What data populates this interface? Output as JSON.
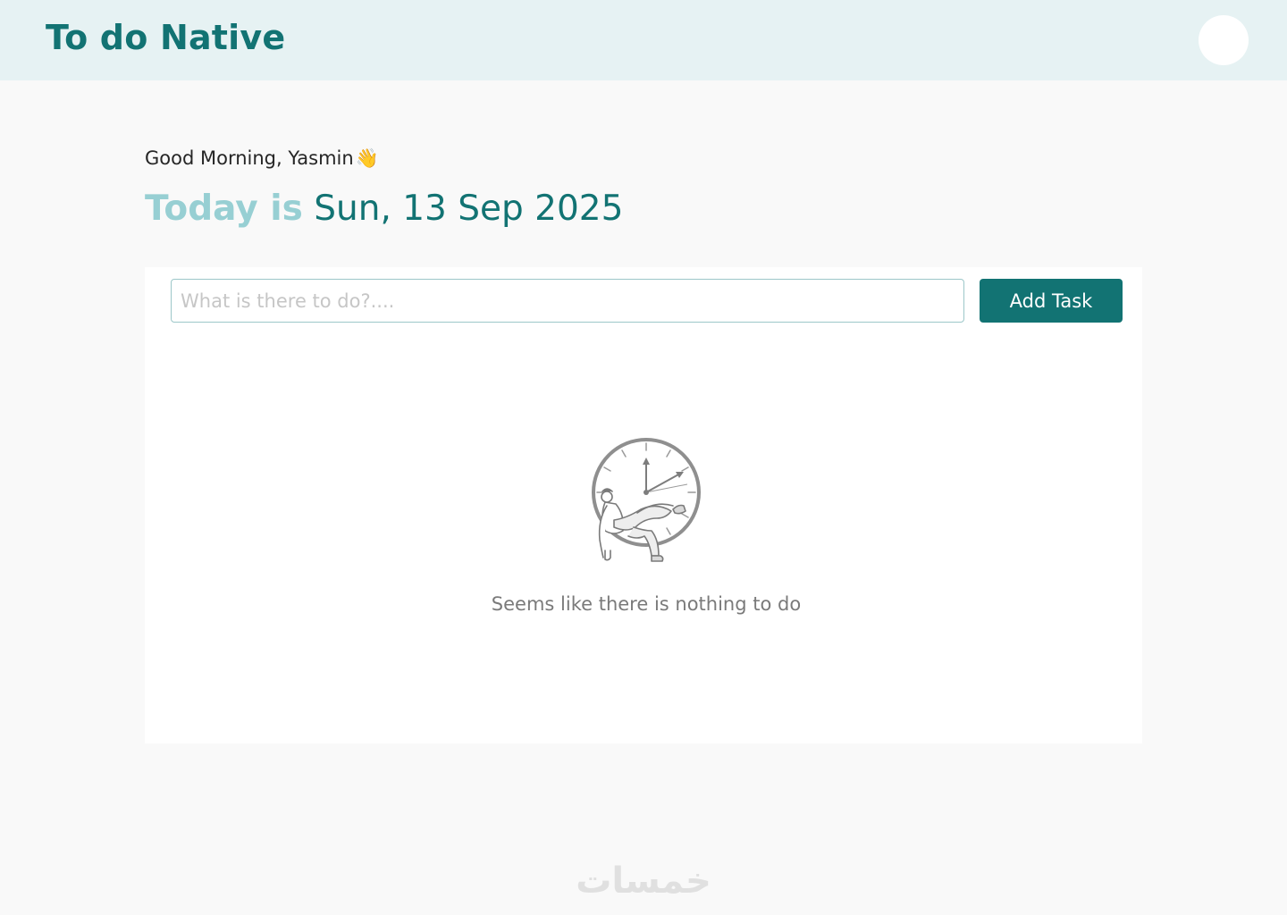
{
  "header": {
    "brand": "To do Native"
  },
  "greeting": {
    "text": "Good Morning, Yasmin",
    "emoji": "👋"
  },
  "today": {
    "prefix": "Today is",
    "date": "Sun, 13 Sep 2025"
  },
  "task_form": {
    "placeholder": "What is there to do?....",
    "value": "",
    "add_label": "Add Task"
  },
  "empty_state": {
    "illustration_icon": "clock-person-relaxing-icon",
    "message": "Seems like there is nothing to do"
  },
  "watermark": {
    "text": "خمسات"
  },
  "colors": {
    "brand": "#127373",
    "accent_light": "#97cfd3",
    "header_bg": "#e6f2f3",
    "page_bg": "#f9f9f9"
  }
}
